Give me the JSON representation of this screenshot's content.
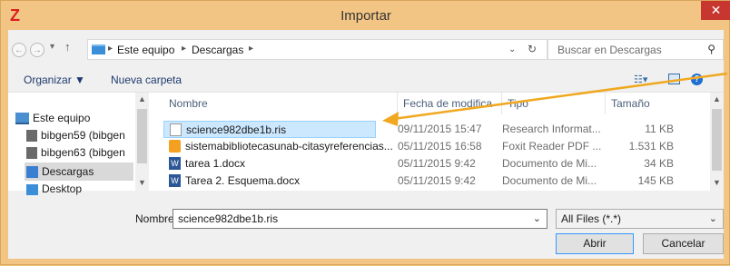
{
  "window": {
    "title": "Importar",
    "app_icon": "Z",
    "close": "✕"
  },
  "address": {
    "breadcrumbs": [
      "Este equipo",
      "Descargas"
    ],
    "search_placeholder": "Buscar en Descargas"
  },
  "toolbar": {
    "organize": "Organizar ▼",
    "new_folder": "Nueva carpeta"
  },
  "nav": {
    "items": [
      {
        "label": "Este equipo"
      },
      {
        "label": "bibgen59 (bibgen"
      },
      {
        "label": "bibgen63 (bibgen"
      },
      {
        "label": "Descargas"
      },
      {
        "label": "Desktop"
      }
    ]
  },
  "columns": {
    "name": "Nombre",
    "date": "Fecha de modifica",
    "type": "Tipo",
    "size": "Tamaño"
  },
  "files": [
    {
      "name": "science982dbe1b.ris",
      "date": "09/11/2015 15:47",
      "type": "Research Informat...",
      "size": "11 KB"
    },
    {
      "name": "sistemabibliotecasunab-citasyreferencias...",
      "date": "05/11/2015 16:58",
      "type": "Foxit Reader PDF ...",
      "size": "1.531 KB"
    },
    {
      "name": "tarea 1.docx",
      "date": "05/11/2015 9:42",
      "type": "Documento de Mi...",
      "size": "34 KB"
    },
    {
      "name": "Tarea 2. Esquema.docx",
      "date": "05/11/2015 9:42",
      "type": "Documento de Mi...",
      "size": "145 KB"
    }
  ],
  "footer": {
    "name_label": "Nombre:",
    "file_name": "science982dbe1b.ris",
    "filter": "All Files (*.*)",
    "open": "Abrir",
    "cancel": "Cancelar"
  },
  "colors": {
    "accent_arrow": "#f0a820",
    "title_bg": "#f3c585",
    "close_red": "#c7372f"
  }
}
